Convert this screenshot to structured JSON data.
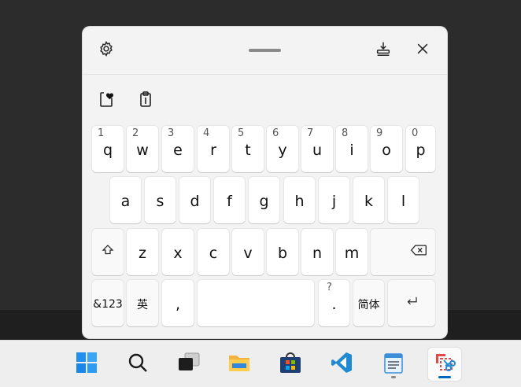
{
  "keyboard": {
    "icons": {
      "settings": "gear-icon",
      "dock": "dock-icon",
      "close": "close-icon",
      "favorites": "clipboard-heart-icon",
      "clipboard": "clipboard-icon"
    },
    "row1": [
      {
        "num": "1",
        "char": "q"
      },
      {
        "num": "2",
        "char": "w"
      },
      {
        "num": "3",
        "char": "e"
      },
      {
        "num": "4",
        "char": "r"
      },
      {
        "num": "5",
        "char": "t"
      },
      {
        "num": "6",
        "char": "y"
      },
      {
        "num": "7",
        "char": "u"
      },
      {
        "num": "8",
        "char": "i"
      },
      {
        "num": "9",
        "char": "o"
      },
      {
        "num": "0",
        "char": "p"
      }
    ],
    "row2": [
      "a",
      "s",
      "d",
      "f",
      "g",
      "h",
      "j",
      "k",
      "l"
    ],
    "row3": [
      "z",
      "x",
      "c",
      "v",
      "b",
      "n",
      "m"
    ],
    "row4": {
      "symbols_label": "&123",
      "ime_label": "英",
      "comma_label": ",",
      "period_label": ".",
      "period_alt": "?",
      "lang_label": "简体"
    },
    "key_icons": {
      "shift": "shift-icon",
      "backspace": "backspace-icon",
      "enter": "enter-icon"
    }
  },
  "taskbar": {
    "items": [
      "start-icon",
      "search-icon",
      "task-view-icon",
      "file-explorer-icon",
      "microsoft-store-icon",
      "vscode-icon",
      "notepad-icon",
      "snipping-tool-icon"
    ],
    "active": "snipping-tool-icon",
    "colors": {
      "accent": "#0067c0",
      "running": "#8a8a8a"
    }
  }
}
